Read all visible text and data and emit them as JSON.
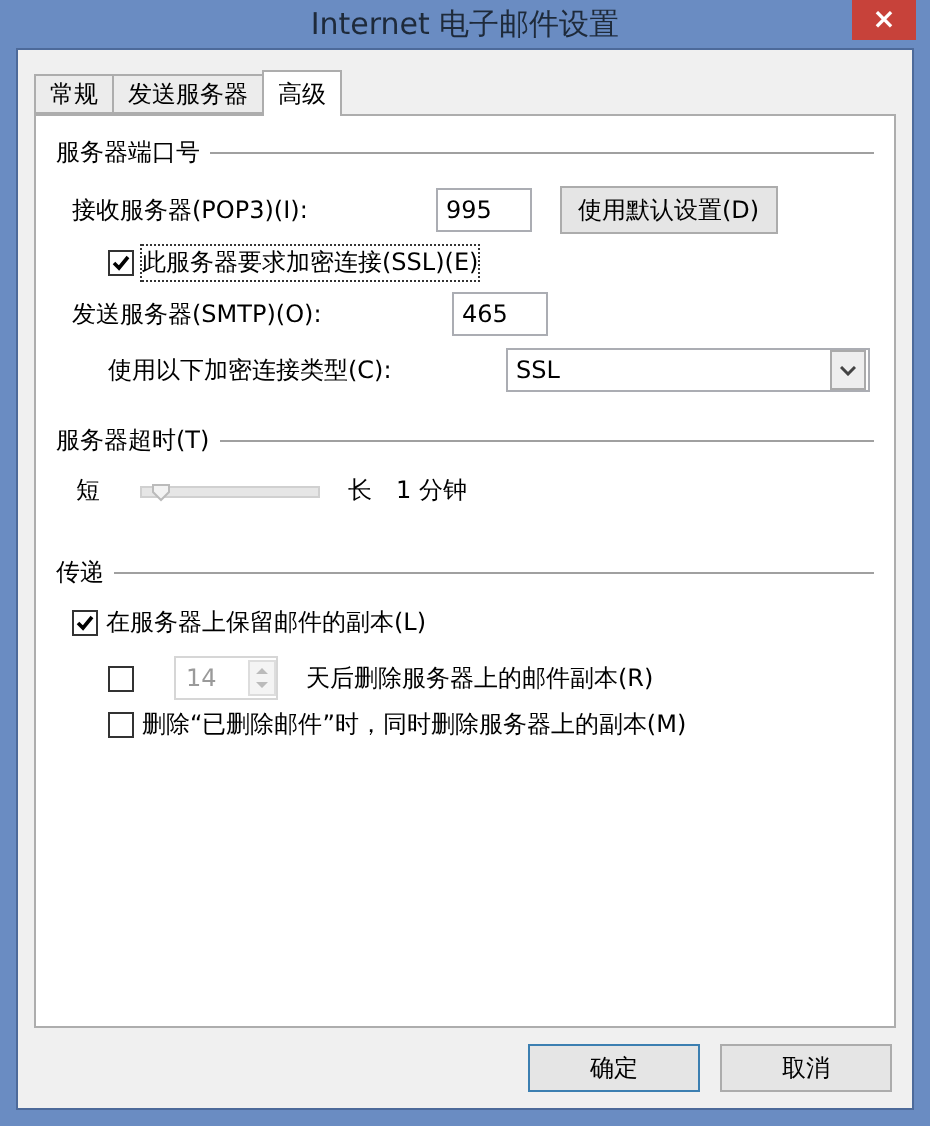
{
  "window": {
    "title": "Internet 电子邮件设置",
    "close": "×"
  },
  "tabs": [
    {
      "label": "常规",
      "selected": false
    },
    {
      "label": "发送服务器",
      "selected": false
    },
    {
      "label": "高级",
      "selected": true
    }
  ],
  "ports": {
    "heading": "服务器端口号",
    "incoming": {
      "label": "接收服务器(POP3)(I):",
      "value": "995"
    },
    "default_button": "使用默认设置(D)",
    "ssl": {
      "label": "此服务器要求加密连接(SSL)(E)",
      "checked": true
    },
    "outgoing": {
      "label": "发送服务器(SMTP)(O):",
      "value": "465"
    },
    "encryption": {
      "label": "使用以下加密连接类型(C):",
      "value": "SSL"
    }
  },
  "timeout": {
    "heading": "服务器超时(T)",
    "short": "短",
    "long": "长",
    "level": 0.1,
    "reading": "1 分钟"
  },
  "delivery": {
    "heading": "传递",
    "options": [
      {
        "kind": "check",
        "label": "在服务器上保留邮件的副本(L)",
        "checked": true
      },
      {
        "kind": "spin",
        "checked": false,
        "days": {
          "value": "14",
          "disabled": true
        },
        "label": "天后删除服务器上的邮件副本(R)"
      },
      {
        "kind": "check",
        "label": "删除“已删除邮件”时，同时删除服务器上的副本(M)",
        "checked": false
      }
    ]
  },
  "buttons": [
    {
      "label": "确定",
      "default": true
    },
    {
      "label": "取消",
      "default": false
    }
  ]
}
